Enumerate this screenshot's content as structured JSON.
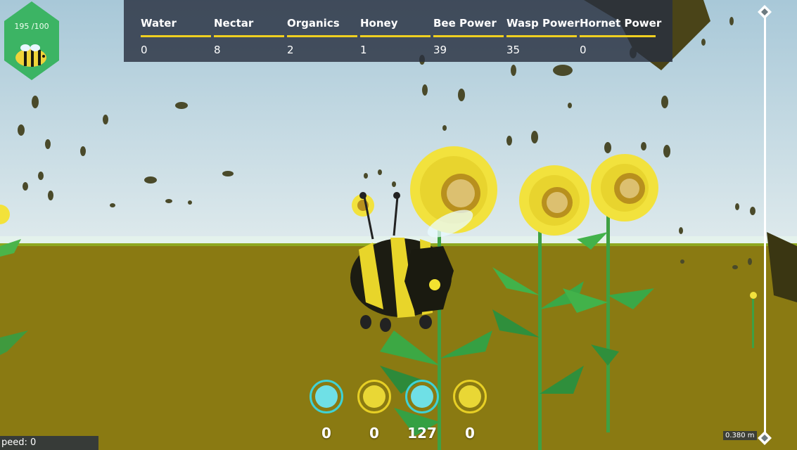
{
  "resources": [
    {
      "label": "Water",
      "value": "0"
    },
    {
      "label": "Nectar",
      "value": "8"
    },
    {
      "label": "Organics",
      "value": "2"
    },
    {
      "label": "Honey",
      "value": "1"
    },
    {
      "label": "Bee Power",
      "value": "39"
    },
    {
      "label": "Wasp Power",
      "value": "35"
    },
    {
      "label": "Hornet Power",
      "value": "0"
    }
  ],
  "health": {
    "text": "195 /100",
    "icon": "bee-icon"
  },
  "inventory": [
    {
      "type": "water",
      "icon": "water-droplet-icon",
      "count": "0"
    },
    {
      "type": "pollen",
      "icon": "pollen-flower-icon",
      "count": "0"
    },
    {
      "type": "water",
      "icon": "water-droplet-icon",
      "count": "127"
    },
    {
      "type": "pollen",
      "icon": "pollen-flower-icon",
      "count": "0"
    }
  ],
  "speed": {
    "text": "peed: 0"
  },
  "altitude": {
    "text": "0.380 m"
  },
  "colors": {
    "sky": "#b8d0da",
    "ground": "#8a7a12",
    "panel": "#283040",
    "accent_yellow": "#f0d020",
    "water_cyan": "#3fd2d6",
    "health_green": "#3cb464"
  }
}
